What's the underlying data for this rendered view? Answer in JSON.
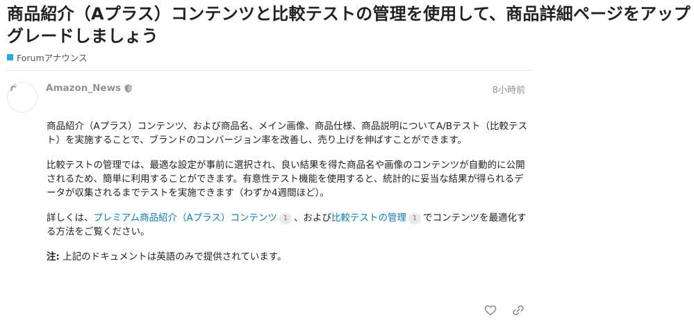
{
  "topic": {
    "title": "商品紹介（Aプラス）コンテンツと比較テストの管理を使用して、商品詳細ページをアップグレードしましょう",
    "category": {
      "label": "Forumアナウンス",
      "color": "#25aae1"
    }
  },
  "post": {
    "username": "Amazon_News",
    "date": "8小時前",
    "paragraphs": {
      "p1": "商品紹介（Aプラス）コンテンツ、および商品名、メイン画像、商品仕様、商品説明についてA/Bテスト（比較テスト）を実施することで、ブランドのコンバージョン率を改善し、売り上げを伸ばすことができます。",
      "p2": "比較テストの管理では、最適な設定が事前に選択され、良い結果を得た商品名や画像のコンテンツが自動的に公開されるため、簡単に利用することができます。有意性テスト機能を使用すると、統計的に妥当な結果が得られるデータが収集されるまでテストを実施できます（わずか4週間ほど）。",
      "p3": {
        "prefix": "詳しくは、",
        "link1": "プレミアム商品紹介（Aプラス）コンテンツ",
        "link1_clicks": "1",
        "middle": "、および",
        "link2": "比較テストの管理",
        "link2_clicks": "1",
        "suffix": "でコンテンツを最適化する方法をご覧ください。"
      },
      "p4": {
        "label": "注:",
        "text": " 上記のドキュメントは英語のみで提供されています。"
      }
    }
  },
  "icons": {
    "avatar": "broken-image-icon",
    "moderator": "shield-icon",
    "like": "heart-icon",
    "share": "link-icon"
  },
  "colors": {
    "link": "#0f7bb5",
    "muted": "#919191",
    "category": "#25aae1"
  }
}
